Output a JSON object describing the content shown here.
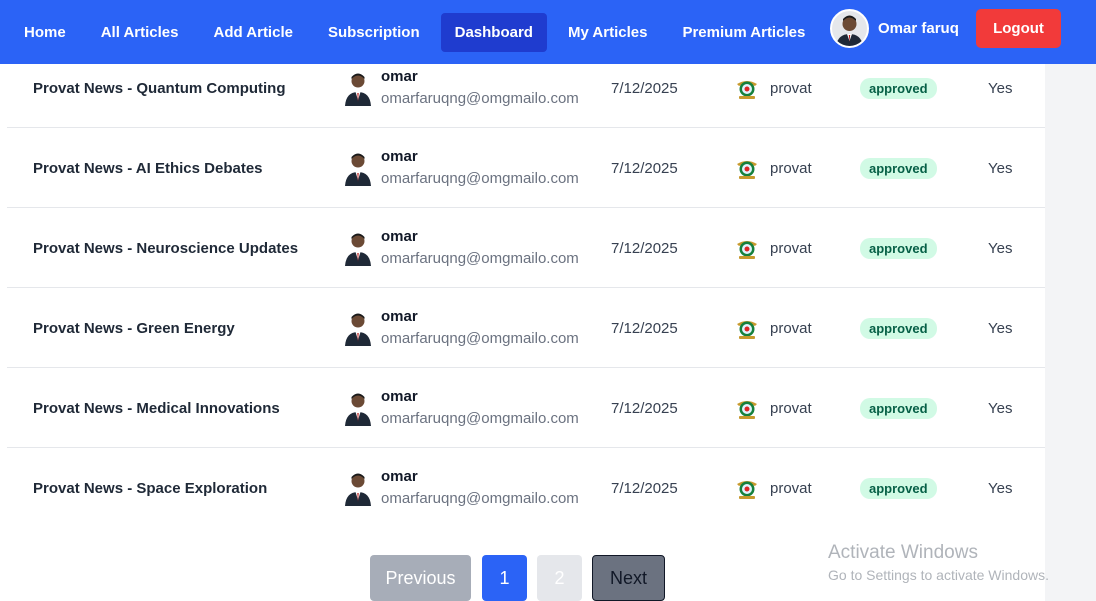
{
  "nav": {
    "links": [
      {
        "label": "Home"
      },
      {
        "label": "All Articles"
      },
      {
        "label": "Add Article"
      },
      {
        "label": "Subscription"
      },
      {
        "label": "Dashboard",
        "active": true
      },
      {
        "label": "My Articles"
      },
      {
        "label": "Premium Articles"
      }
    ],
    "user_name": "Omar faruq",
    "logout_label": "Logout"
  },
  "rows": [
    {
      "title": "Provat News - Quantum Computing",
      "author_name": "omar",
      "author_email": "omarfaruqng@omgmailo.com",
      "date": "7/12/2025",
      "publisher": "provat",
      "status": "approved",
      "premium": "Yes"
    },
    {
      "title": "Provat News - AI Ethics Debates",
      "author_name": "omar",
      "author_email": "omarfaruqng@omgmailo.com",
      "date": "7/12/2025",
      "publisher": "provat",
      "status": "approved",
      "premium": "Yes"
    },
    {
      "title": "Provat News - Neuroscience Updates",
      "author_name": "omar",
      "author_email": "omarfaruqng@omgmailo.com",
      "date": "7/12/2025",
      "publisher": "provat",
      "status": "approved",
      "premium": "Yes"
    },
    {
      "title": "Provat News - Green Energy",
      "author_name": "omar",
      "author_email": "omarfaruqng@omgmailo.com",
      "date": "7/12/2025",
      "publisher": "provat",
      "status": "approved",
      "premium": "Yes"
    },
    {
      "title": "Provat News - Medical Innovations",
      "author_name": "omar",
      "author_email": "omarfaruqng@omgmailo.com",
      "date": "7/12/2025",
      "publisher": "provat",
      "status": "approved",
      "premium": "Yes"
    },
    {
      "title": "Provat News - Space Exploration",
      "author_name": "omar",
      "author_email": "omarfaruqng@omgmailo.com",
      "date": "7/12/2025",
      "publisher": "provat",
      "status": "approved",
      "premium": "Yes"
    }
  ],
  "pagination": {
    "previous_label": "Previous",
    "page_1": "1",
    "page_2": "2",
    "next_label": "Next"
  },
  "watermark": {
    "title": "Activate Windows",
    "subtitle": "Go to Settings to activate Windows."
  },
  "colors": {
    "nav_bg": "#2b63f6",
    "nav_active": "#1f3ccf",
    "logout": "#f23a3a",
    "badge_bg": "#d1fae5",
    "badge_text": "#065f46"
  }
}
